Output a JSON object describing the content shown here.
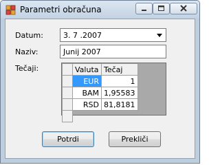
{
  "window": {
    "title": "Parametri obračuna"
  },
  "form": {
    "datum_label": "Datum:",
    "datum_value": "3. 7 .2007",
    "naziv_label": "Naziv:",
    "naziv_value": "Junij 2007",
    "tecaji_label": "Tečaji:"
  },
  "grid": {
    "columns": [
      "Valuta",
      "Tečaj"
    ],
    "rows": [
      {
        "valuta": "EUR",
        "tecaj": "1"
      },
      {
        "valuta": "BAM",
        "tecaj": "1,95583"
      },
      {
        "valuta": "RSD",
        "tecaj": "81,8181"
      }
    ],
    "selected_row": 0,
    "selection_color": "#3399ff"
  },
  "buttons": {
    "ok_label": "Potrdi",
    "cancel_label": "Prekliči"
  }
}
